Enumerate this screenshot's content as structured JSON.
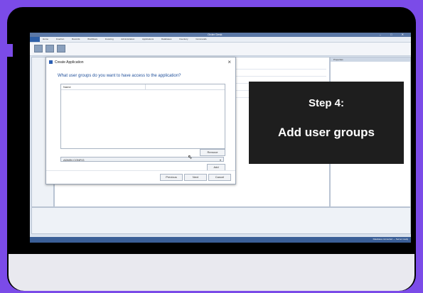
{
  "window": {
    "title": "Order Desk",
    "controls": "– □ ✕"
  },
  "ribbon": {
    "file_label": "File",
    "tabs": "Home Insertion Records Workflows Invoicing Administration Applications Databases Inventory Commands"
  },
  "right_panel": {
    "header": "Properties"
  },
  "statusbar": {
    "text": "Database connected — Server ready"
  },
  "dialog": {
    "title": "Create Application",
    "question": "What user groups do you want to have access to the application?",
    "list_header": "Name",
    "remove_label": "Remove",
    "dropdown_value": "ADMIN CONFIG",
    "add_label": "Add",
    "previous_label": "Previous",
    "next_label": "Next",
    "cancel_label": "Cancel"
  },
  "overlay": {
    "step_title": "Step 4:",
    "step_text": "Add user groups"
  },
  "colors": {
    "purple_accent": "#7b4be8",
    "title_blue": "#1f4f9a",
    "overlay_bg": "#1e1e1e"
  }
}
